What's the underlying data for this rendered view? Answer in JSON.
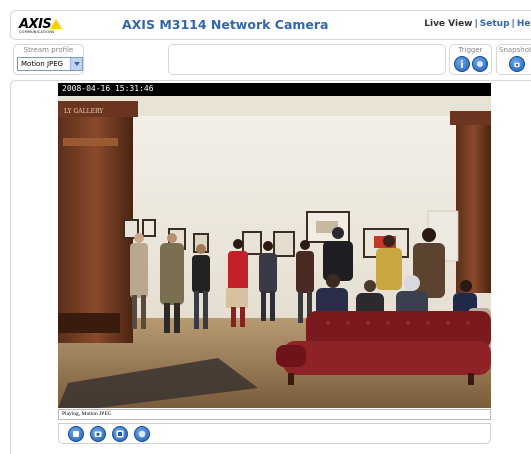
{
  "header": {
    "logo_text": "AXIS",
    "logo_sub": "COMMUNICATIONS",
    "title": "AXIS M3114 Network Camera",
    "nav": {
      "live_view": "Live View",
      "separator": "|",
      "setup": "Setup",
      "help": "Help"
    }
  },
  "controls": {
    "stream_profile": {
      "label": "Stream profile",
      "selected": "Motion JPEG"
    },
    "trigger": {
      "label": "Trigger"
    },
    "snapshot": {
      "label": "Snapshot"
    }
  },
  "video": {
    "timestamp": "2008-04-16 15:31:46",
    "status": "Playing, Motion JPEG",
    "scene": {
      "gallery_sign": "LY GALLERY"
    }
  },
  "playback_buttons": [
    "stop-icon",
    "record-icon",
    "snapshot-icon",
    "fullscreen-icon"
  ],
  "colors": {
    "title_blue": "#3366aa",
    "button_blue": "#1e5fb4",
    "logo_yellow": "#ffcc00"
  }
}
